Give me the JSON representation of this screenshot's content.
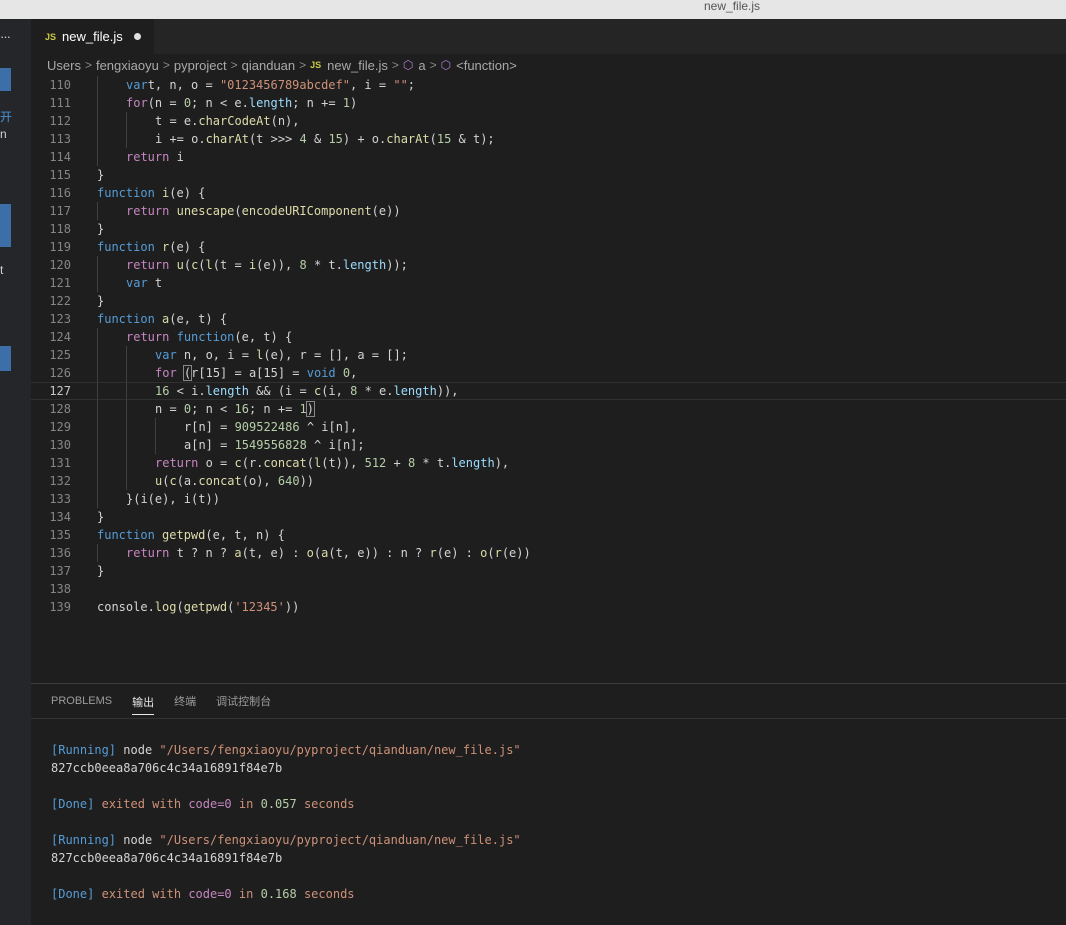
{
  "window": {
    "title": "new_file.js"
  },
  "leftbar": {
    "more": "···",
    "glyph1": "开",
    "glyph2": "n",
    "glyph3": "t"
  },
  "tab": {
    "badge": "JS",
    "name": "new_file.js"
  },
  "breadcrumb": {
    "items": [
      "Users",
      "fengxiaoyu",
      "pyproject",
      "qianduan"
    ],
    "file_badge": "JS",
    "file": "new_file.js",
    "symbol1": "a",
    "symbol2": "<function>"
  },
  "editor": {
    "active_line": "127",
    "lines": [
      {
        "n": "110",
        "indent": 1
      },
      {
        "n": "111",
        "indent": 1
      },
      {
        "n": "112",
        "indent": 2
      },
      {
        "n": "113",
        "indent": 2
      },
      {
        "n": "114",
        "indent": 1
      },
      {
        "n": "115",
        "indent": 0
      },
      {
        "n": "116",
        "indent": 0
      },
      {
        "n": "117",
        "indent": 1
      },
      {
        "n": "118",
        "indent": 0
      },
      {
        "n": "119",
        "indent": 0
      },
      {
        "n": "120",
        "indent": 1
      },
      {
        "n": "121",
        "indent": 1
      },
      {
        "n": "122",
        "indent": 0
      },
      {
        "n": "123",
        "indent": 0
      },
      {
        "n": "124",
        "indent": 1
      },
      {
        "n": "125",
        "indent": 2
      },
      {
        "n": "126",
        "indent": 2
      },
      {
        "n": "127",
        "indent": 2
      },
      {
        "n": "128",
        "indent": 2
      },
      {
        "n": "129",
        "indent": 3
      },
      {
        "n": "130",
        "indent": 3
      },
      {
        "n": "131",
        "indent": 2
      },
      {
        "n": "132",
        "indent": 2
      },
      {
        "n": "133",
        "indent": 1
      },
      {
        "n": "134",
        "indent": 0
      },
      {
        "n": "135",
        "indent": 0
      },
      {
        "n": "136",
        "indent": 1
      },
      {
        "n": "137",
        "indent": 0
      },
      {
        "n": "138",
        "indent": 0
      },
      {
        "n": "139",
        "indent": 0
      }
    ],
    "tokens": [
      [
        [
          "kw",
          "var"
        ],
        [
          "",
          "t, n, o = "
        ],
        [
          "str",
          "\"0123456789abcdef\""
        ],
        [
          "",
          ", i = "
        ],
        [
          "str",
          "\"\""
        ],
        [
          "",
          ";"
        ]
      ],
      [
        [
          "ctl",
          "for"
        ],
        [
          "",
          "(n = "
        ],
        [
          "num",
          "0"
        ],
        [
          "",
          "; n < e."
        ],
        [
          "var",
          "length"
        ],
        [
          "",
          "; n += "
        ],
        [
          "num",
          "1"
        ],
        [
          "",
          ")"
        ]
      ],
      [
        [
          "",
          "t = e."
        ],
        [
          "fn",
          "charCodeAt"
        ],
        [
          "",
          "(n),"
        ]
      ],
      [
        [
          "",
          "i += o."
        ],
        [
          "fn",
          "charAt"
        ],
        [
          "",
          "(t >>> "
        ],
        [
          "num",
          "4"
        ],
        [
          "",
          " & "
        ],
        [
          "num",
          "15"
        ],
        [
          "",
          ") + o."
        ],
        [
          "fn",
          "charAt"
        ],
        [
          "",
          "("
        ],
        [
          "num",
          "15"
        ],
        [
          "",
          " & t);"
        ]
      ],
      [
        [
          "ctl",
          "return"
        ],
        [
          "",
          " i"
        ]
      ],
      [
        [
          "",
          "}"
        ]
      ],
      [
        [
          "kw",
          "function"
        ],
        [
          "",
          " "
        ],
        [
          "fn",
          "i"
        ],
        [
          "",
          "(e) {"
        ]
      ],
      [
        [
          "ctl",
          "return"
        ],
        [
          "",
          " "
        ],
        [
          "fn",
          "unescape"
        ],
        [
          "",
          "("
        ],
        [
          "fn",
          "encodeURIComponent"
        ],
        [
          "",
          "(e))"
        ]
      ],
      [
        [
          "",
          "}"
        ]
      ],
      [
        [
          "kw",
          "function"
        ],
        [
          "",
          " "
        ],
        [
          "fn",
          "r"
        ],
        [
          "",
          "(e) {"
        ]
      ],
      [
        [
          "ctl",
          "return"
        ],
        [
          "",
          " "
        ],
        [
          "fn",
          "u"
        ],
        [
          "",
          "("
        ],
        [
          "fn",
          "c"
        ],
        [
          "",
          "("
        ],
        [
          "fn",
          "l"
        ],
        [
          "",
          "(t = "
        ],
        [
          "fn",
          "i"
        ],
        [
          "",
          "(e)), "
        ],
        [
          "num",
          "8"
        ],
        [
          "",
          " * t."
        ],
        [
          "var",
          "length"
        ],
        [
          "",
          "));"
        ]
      ],
      [
        [
          "kw",
          "var"
        ],
        [
          "",
          " t"
        ]
      ],
      [
        [
          "",
          "}"
        ]
      ],
      [
        [
          "kw",
          "function"
        ],
        [
          "",
          " "
        ],
        [
          "fn",
          "a"
        ],
        [
          "",
          "(e, t) {"
        ]
      ],
      [
        [
          "ctl",
          "return"
        ],
        [
          "",
          " "
        ],
        [
          "kw",
          "function"
        ],
        [
          "",
          "(e, t) {"
        ]
      ],
      [
        [
          "kw",
          "var"
        ],
        [
          "",
          " n, o, i = "
        ],
        [
          "fn",
          "l"
        ],
        [
          "",
          "(e), r = [], a = [];"
        ]
      ],
      [
        [
          "ctl",
          "for"
        ],
        [
          "",
          " "
        ],
        [
          "cur",
          "("
        ],
        [
          "",
          "r[15] = a[15] = "
        ],
        [
          "kw",
          "void"
        ],
        [
          "",
          " "
        ],
        [
          "num",
          "0"
        ],
        [
          "",
          ","
        ]
      ],
      [
        [
          "num",
          "16"
        ],
        [
          "",
          " < i."
        ],
        [
          "var",
          "length"
        ],
        [
          "",
          " && (i = "
        ],
        [
          "fn",
          "c"
        ],
        [
          "",
          "(i, "
        ],
        [
          "num",
          "8"
        ],
        [
          "",
          " * e."
        ],
        [
          "var",
          "length"
        ],
        [
          "",
          ")),"
        ]
      ],
      [
        [
          "",
          "n = "
        ],
        [
          "num",
          "0"
        ],
        [
          "",
          "; n < "
        ],
        [
          "num",
          "16"
        ],
        [
          "",
          "; n += "
        ],
        [
          "num",
          "1"
        ],
        [
          "cur",
          ")"
        ]
      ],
      [
        [
          "",
          "r[n] = "
        ],
        [
          "num",
          "909522486"
        ],
        [
          "",
          " ^ i[n],"
        ]
      ],
      [
        [
          "",
          "a[n] = "
        ],
        [
          "num",
          "1549556828"
        ],
        [
          "",
          " ^ i[n];"
        ]
      ],
      [
        [
          "ctl",
          "return"
        ],
        [
          "",
          " o = "
        ],
        [
          "fn",
          "c"
        ],
        [
          "",
          "(r."
        ],
        [
          "fn",
          "concat"
        ],
        [
          "",
          "("
        ],
        [
          "fn",
          "l"
        ],
        [
          "",
          "(t)), "
        ],
        [
          "num",
          "512"
        ],
        [
          "",
          " + "
        ],
        [
          "num",
          "8"
        ],
        [
          "",
          " * t."
        ],
        [
          "var",
          "length"
        ],
        [
          "",
          "),"
        ]
      ],
      [
        [
          "fn",
          "u"
        ],
        [
          "",
          "("
        ],
        [
          "fn",
          "c"
        ],
        [
          "",
          "(a."
        ],
        [
          "fn",
          "concat"
        ],
        [
          "",
          "(o), "
        ],
        [
          "num",
          "640"
        ],
        [
          "",
          "))"
        ]
      ],
      [
        [
          "",
          "}(i(e), i(t))"
        ]
      ],
      [
        [
          "",
          "}"
        ]
      ],
      [
        [
          "kw",
          "function"
        ],
        [
          "",
          " "
        ],
        [
          "fn",
          "getpwd"
        ],
        [
          "",
          "(e, t, n) {"
        ]
      ],
      [
        [
          "ctl",
          "return"
        ],
        [
          "",
          " t ? n ? "
        ],
        [
          "fn",
          "a"
        ],
        [
          "",
          "(t, e) : "
        ],
        [
          "fn",
          "o"
        ],
        [
          "",
          "("
        ],
        [
          "fn",
          "a"
        ],
        [
          "",
          "(t, e)) : n ? "
        ],
        [
          "fn",
          "r"
        ],
        [
          "",
          "(e) : "
        ],
        [
          "fn",
          "o"
        ],
        [
          "",
          "("
        ],
        [
          "fn",
          "r"
        ],
        [
          "",
          "(e))"
        ]
      ],
      [
        [
          "",
          "}"
        ]
      ],
      [
        [
          "",
          ""
        ]
      ],
      [
        [
          "",
          "console."
        ],
        [
          "fn",
          "log"
        ],
        [
          "",
          "("
        ],
        [
          "fn",
          "getpwd"
        ],
        [
          "",
          "("
        ],
        [
          "str",
          "'12345'"
        ],
        [
          "",
          "))"
        ]
      ]
    ]
  },
  "panel": {
    "tabs": [
      "PROBLEMS",
      "输出",
      "终端",
      "调试控制台"
    ],
    "active_tab": "输出",
    "runs": [
      {
        "running_tag": "[Running]",
        "command": "node",
        "path": "\"/Users/fengxiaoyu/pyproject/qianduan/new_file.js\"",
        "output": "827ccb0eea8a706c4c34a16891f84e7b",
        "done_tag": "[Done]",
        "exited": "exited with",
        "code": "code=0",
        "in": "in",
        "seconds_value": "0.057",
        "seconds": "seconds"
      },
      {
        "running_tag": "[Running]",
        "command": "node",
        "path": "\"/Users/fengxiaoyu/pyproject/qianduan/new_file.js\"",
        "output": "827ccb0eea8a706c4c34a16891f84e7b",
        "done_tag": "[Done]",
        "exited": "exited with",
        "code": "code=0",
        "in": "in",
        "seconds_value": "0.168",
        "seconds": "seconds"
      }
    ]
  }
}
